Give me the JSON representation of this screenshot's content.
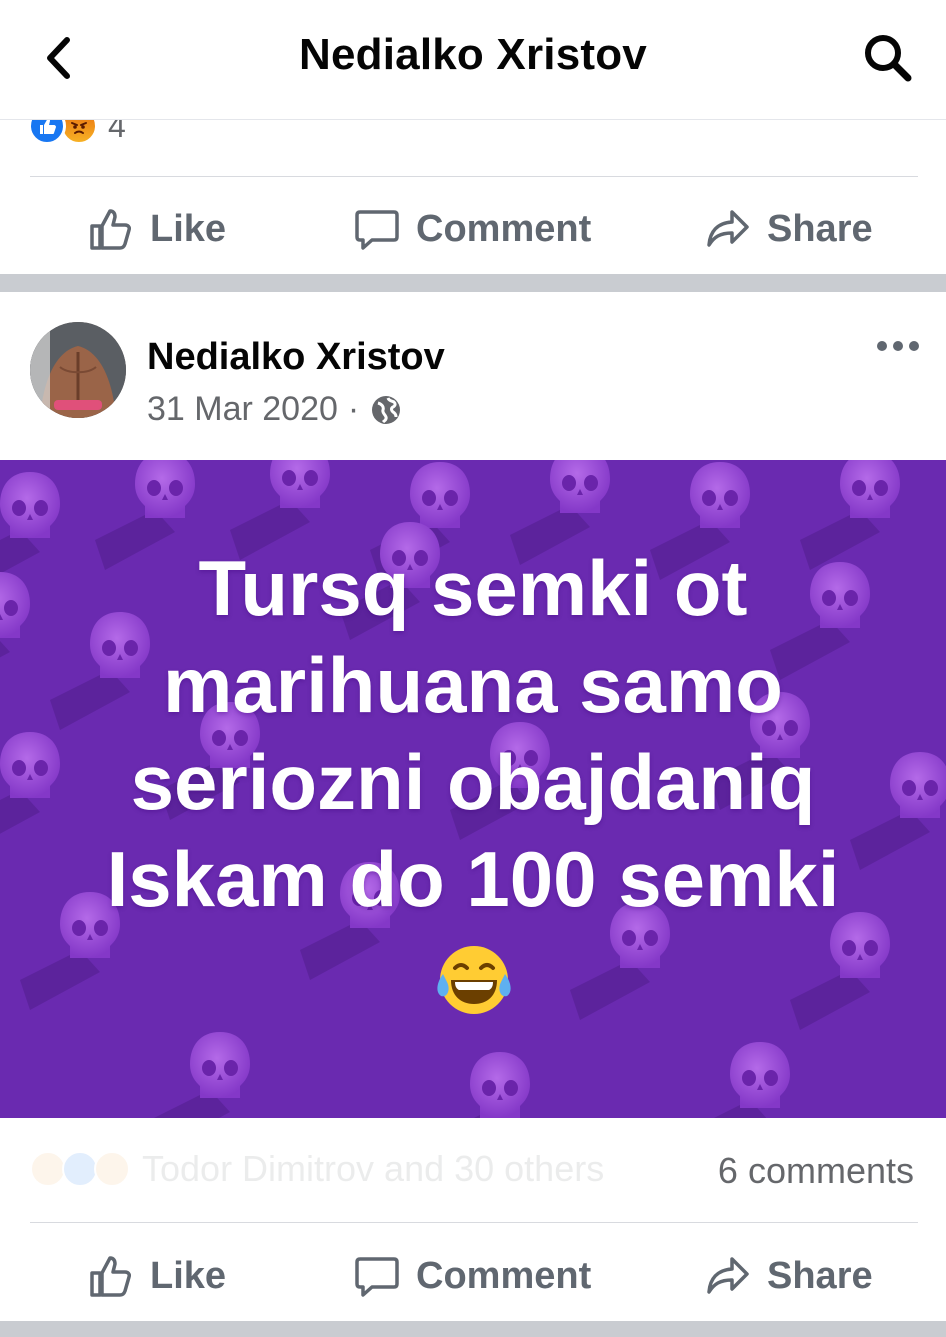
{
  "header": {
    "title": "Nedialko Xristov",
    "back_icon": "chevron-left-icon",
    "search_icon": "search-icon"
  },
  "previous_post": {
    "reaction_count": "4",
    "actions": {
      "like": "Like",
      "comment": "Comment",
      "share": "Share"
    }
  },
  "post": {
    "author": "Nedialko Xristov",
    "date": "31 Mar 2020",
    "separator": "·",
    "audience_icon": "globe-icon",
    "more_icon": "more-horizontal-icon",
    "image_text": [
      "Tursq semki ot",
      "marihuana samo",
      "seriozni obajdaniq",
      "Iskam do 100 semki"
    ],
    "image_emoji": "face-with-tears-of-joy",
    "background_color": "#6a2ab0",
    "reactions_summary": "Todor Dimitrov and 30 others",
    "comments_count": "6 comments",
    "actions": {
      "like": "Like",
      "comment": "Comment",
      "share": "Share"
    }
  },
  "colors": {
    "accent_blue": "#1877f2",
    "action_gray": "#606770",
    "text_secondary": "#65676b"
  }
}
